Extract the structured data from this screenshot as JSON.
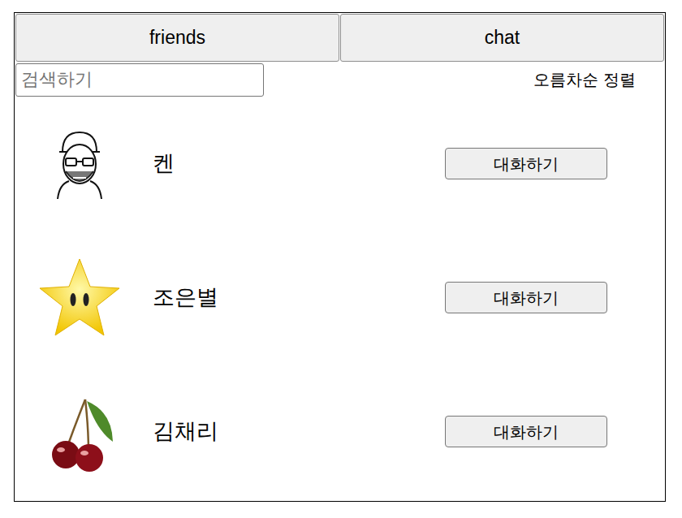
{
  "tabs": [
    {
      "label": "friends",
      "selected": true
    },
    {
      "label": "chat",
      "selected": false
    }
  ],
  "search": {
    "placeholder": "검색하기"
  },
  "sort": {
    "label": "오름차순 정렬"
  },
  "friends": [
    {
      "name": "켄",
      "avatar": "face",
      "button": "대화하기"
    },
    {
      "name": "조은별",
      "avatar": "star",
      "button": "대화하기"
    },
    {
      "name": "김채리",
      "avatar": "cherry",
      "button": "대화하기"
    }
  ]
}
